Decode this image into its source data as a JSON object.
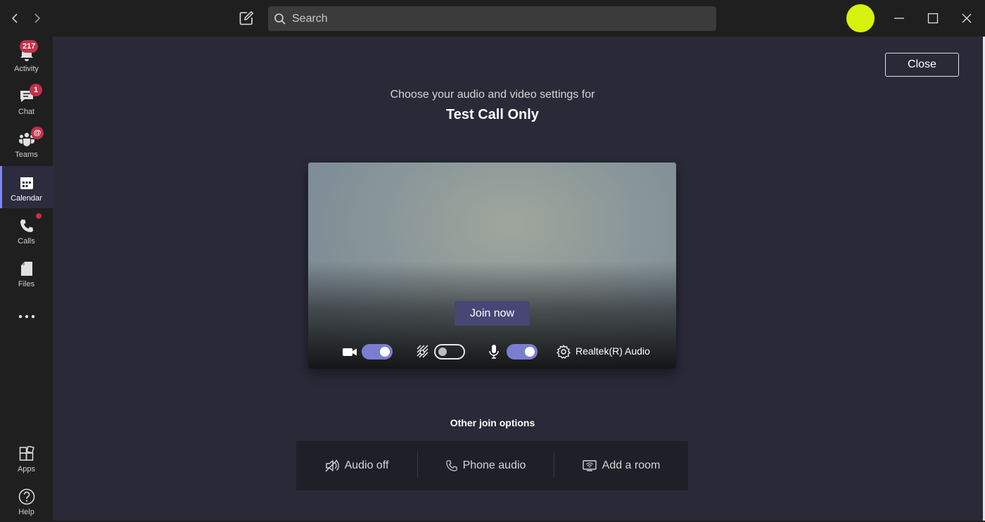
{
  "titlebar": {
    "search_placeholder": "Search"
  },
  "rail": {
    "items": [
      {
        "label": "Activity",
        "badge": "217"
      },
      {
        "label": "Chat",
        "badge": "1"
      },
      {
        "label": "Teams",
        "badge": "@"
      },
      {
        "label": "Calendar"
      },
      {
        "label": "Calls"
      },
      {
        "label": "Files"
      },
      {
        "label": "Apps"
      },
      {
        "label": "Help"
      }
    ]
  },
  "main": {
    "close_label": "Close",
    "choose_text": "Choose your audio and video settings for",
    "meeting_title": "Test Call Only",
    "join_label": "Join now",
    "device_label": "Realtek(R) Audio",
    "toggles": {
      "camera": true,
      "background_blur": false,
      "microphone": true
    },
    "other_title": "Other join options",
    "options": [
      {
        "label": "Audio off"
      },
      {
        "label": "Phone audio"
      },
      {
        "label": "Add a room"
      }
    ]
  },
  "colors": {
    "accent": "#7a7ed0",
    "join_button": "#464775",
    "badge": "#c4314b",
    "avatar": "#d7f20d"
  }
}
